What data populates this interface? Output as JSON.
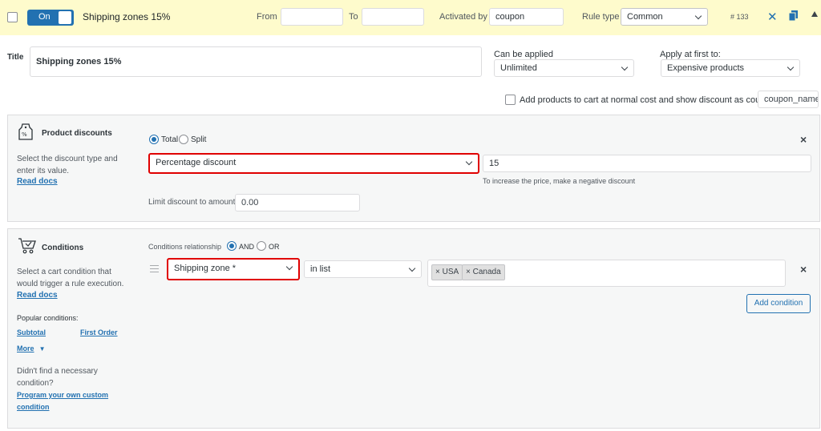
{
  "header": {
    "toggle_label": "On",
    "rule_title": "Shipping zones 15%",
    "from_label": "From",
    "to_label": "To",
    "activated_by_label": "Activated by",
    "activated_by_value": "coupon",
    "rule_type_label": "Rule type",
    "rule_type_value": "Common",
    "rule_id": "# 133"
  },
  "title_section": {
    "title_label": "Title",
    "title_value": "Shipping zones 15%",
    "can_be_applied_label": "Can be applied",
    "can_be_applied_value": "Unlimited",
    "apply_first_label": "Apply at first to:",
    "apply_first_value": "Expensive products",
    "add_products_label": "Add products to cart at normal cost and show discount as coupon",
    "coupon_name_placeholder": "coupon_name"
  },
  "product_discounts": {
    "heading": "Product discounts",
    "description": "Select the discount type and enter its value.",
    "read_docs": "Read docs",
    "option_total": "Total",
    "option_split": "Split",
    "discount_type_value": "Percentage discount",
    "discount_value": "15",
    "hint": "To increase the price, make a negative discount",
    "limit_label": "Limit discount to amount:",
    "limit_placeholder": "0.00"
  },
  "conditions": {
    "heading": "Conditions",
    "description": "Select a cart condition that would trigger a rule execution.",
    "read_docs": "Read docs",
    "relationship_label": "Conditions relationship",
    "option_and": "AND",
    "option_or": "OR",
    "condition_type_value": "Shipping zone *",
    "operator_value": "in list",
    "tags": [
      "USA",
      "Canada"
    ],
    "add_condition_label": "Add condition",
    "popular_label": "Popular conditions:",
    "popular_subtotal": "Subtotal",
    "popular_first_order": "First Order",
    "more_label": "More",
    "not_found_text": "Didn't find a necessary condition?",
    "program_link": "Program your own custom condition"
  },
  "colors": {
    "header_bg": "#fefbcc",
    "accent": "#2271b1",
    "highlight": "#e00000"
  }
}
